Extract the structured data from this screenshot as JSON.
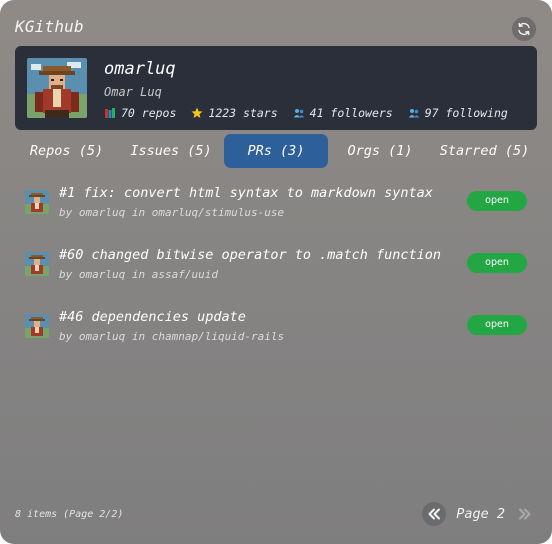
{
  "app": {
    "title": "KGithub"
  },
  "profile": {
    "username": "omarluq",
    "full_name": "Omar Luq",
    "stats": {
      "repos": "70 repos",
      "stars": "1223 stars",
      "followers": "41 followers",
      "following": "97 following"
    }
  },
  "tabs": [
    {
      "label": "Repos (5)",
      "active": false
    },
    {
      "label": "Issues (5)",
      "active": false
    },
    {
      "label": "PRs (3)",
      "active": true
    },
    {
      "label": "Orgs (1)",
      "active": false
    },
    {
      "label": "Starred (5)",
      "active": false
    }
  ],
  "prs": [
    {
      "title": "#1 fix: convert html syntax to markdown syntax",
      "meta": "by omarluq in omarluq/stimulus-use",
      "status": "open"
    },
    {
      "title": "#60 changed bitwise operator to .match function",
      "meta": "by omarluq in assaf/uuid",
      "status": "open"
    },
    {
      "title": "#46 dependencies update",
      "meta": "by omarluq in chamnap/liquid-rails",
      "status": "open"
    }
  ],
  "footer": {
    "items_info": "8 items (Page 2/2)",
    "page_label": "Page 2"
  },
  "icons": {
    "refresh": "refresh-icon",
    "repos": "books-icon",
    "stars": "star-icon",
    "followers": "people-icon",
    "following": "people-icon",
    "prev": "double-chevron-left-icon",
    "next": "double-chevron-right-icon"
  },
  "colors": {
    "profile_bg": "#2a2f3a",
    "active_tab": "#2d5f9a",
    "open_badge": "#22a744"
  }
}
